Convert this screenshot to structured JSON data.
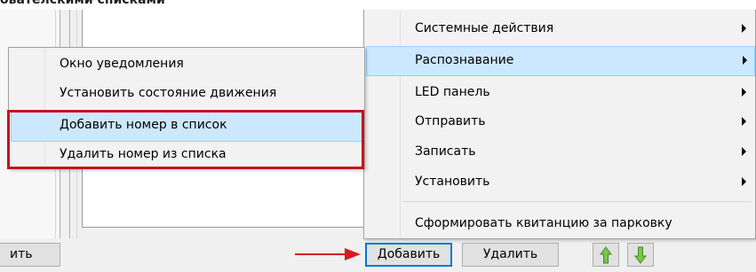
{
  "page": {
    "heading_fragment": "ователскими списками"
  },
  "bottom_bar": {
    "cut_button_label": "ить",
    "add_button_label": "Добавить",
    "delete_button_label": "Удалить",
    "up_icon": "arrow-up-icon",
    "down_icon": "arrow-down-icon"
  },
  "context_menu": {
    "items": [
      {
        "label": "Системные действия",
        "has_submenu": true
      },
      {
        "label": "Распознавание",
        "has_submenu": true,
        "highlighted": true
      },
      {
        "label": "LED панель",
        "has_submenu": true
      },
      {
        "label": "Отправить",
        "has_submenu": true
      },
      {
        "label": "Записать",
        "has_submenu": true
      },
      {
        "label": "Установить",
        "has_submenu": true
      },
      {
        "label": "Сформировать квитанцию за парковку",
        "has_submenu": false
      }
    ]
  },
  "submenu": {
    "items": [
      {
        "label": "Окно уведомления"
      },
      {
        "label": "Установить состояние движения"
      },
      {
        "label": "Добавить номер в список",
        "highlighted": true
      },
      {
        "label": "Удалить номер из списка"
      }
    ]
  },
  "colors": {
    "highlight_bg": "#cce8ff",
    "highlight_border": "#99d1ff",
    "annotation_red": "#c4131b",
    "arrow_green": "#5aa93a"
  }
}
